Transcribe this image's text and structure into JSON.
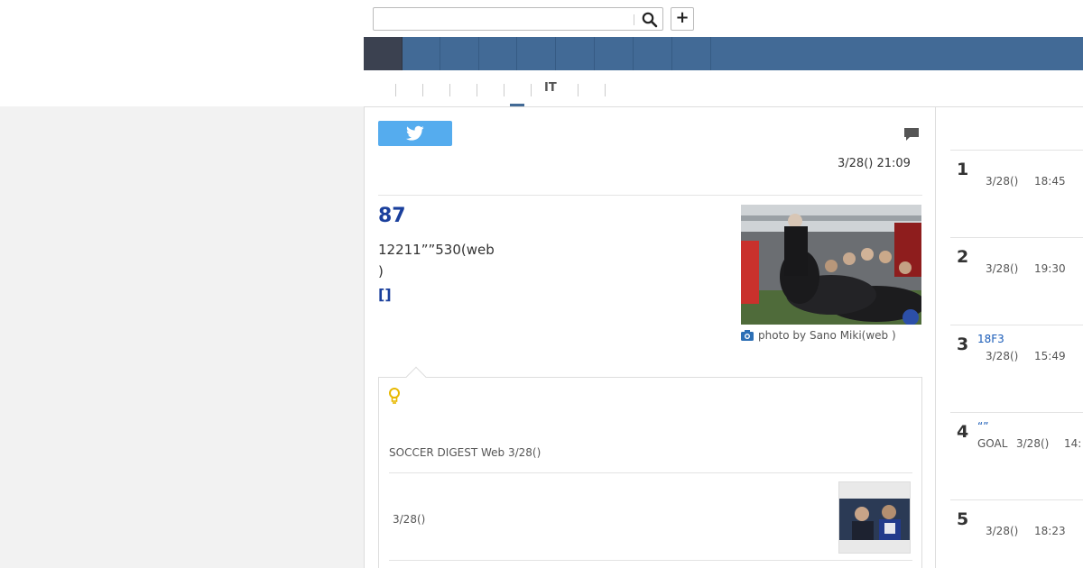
{
  "header": {
    "search": {
      "value": "",
      "placeholder": ""
    },
    "add_label": "+"
  },
  "nav": {
    "items": [
      {
        "id": "home"
      },
      {
        "id": "n1"
      },
      {
        "id": "n2"
      },
      {
        "id": "n3"
      },
      {
        "id": "n4"
      },
      {
        "id": "n5"
      },
      {
        "id": "n6"
      },
      {
        "id": "n7"
      },
      {
        "id": "n8"
      }
    ]
  },
  "categories": {
    "it_label": "IT"
  },
  "article": {
    "datetime": "3/28() 21:09",
    "headline": "87",
    "body_line1": "12211””530(web",
    "body_line2": ")",
    "more_link": "[]",
    "photo_caption": "photo by Sano Miki(web )"
  },
  "related": {
    "source": "SOCCER DIGEST Web 3/28()",
    "item_date": "3/28()"
  },
  "ranking": {
    "items": [
      {
        "rank": "1",
        "title": "",
        "source": "",
        "date": "3/28()",
        "time": "18:45"
      },
      {
        "rank": "2",
        "title": "",
        "source": "",
        "date": "3/28()",
        "time": "19:30"
      },
      {
        "rank": "3",
        "title": "18F3",
        "source": "",
        "date": "3/28()",
        "time": "15:49"
      },
      {
        "rank": "4",
        "title": "“”",
        "source": "GOAL",
        "date": "3/28()",
        "time": "14:"
      },
      {
        "rank": "5",
        "title": "",
        "source": "",
        "date": "3/28()",
        "time": "18:23"
      }
    ]
  },
  "colors": {
    "nav_blue": "#426a96",
    "nav_home": "#3b4150",
    "link_blue": "#1a3f9c",
    "twitter": "#55acee",
    "bulb": "#e8b800"
  }
}
